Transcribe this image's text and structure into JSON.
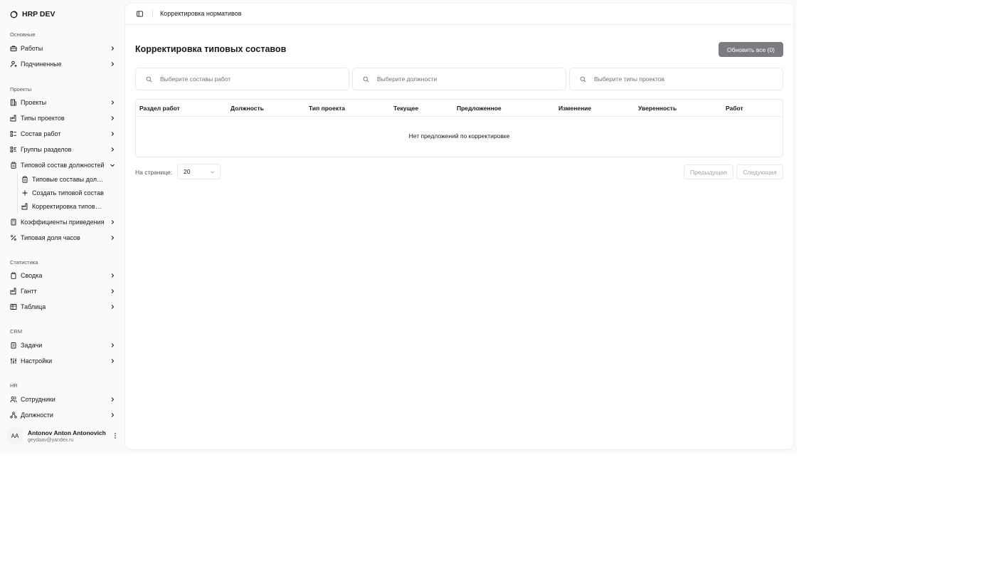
{
  "brand": {
    "name": "HRP DEV",
    "icon": "logo-icon"
  },
  "sidebar": {
    "groups": {
      "main": "Основные",
      "projects": "Проекты",
      "stats": "Статистика",
      "crm": "CRM",
      "hr": "HR"
    },
    "items": {
      "works": "Работы",
      "subordinates": "Подчиненные",
      "projects": "Проекты",
      "project_types": "Типы проектов",
      "work_composition": "Состав работ",
      "section_groups": "Группы разделов",
      "typical_positions": "Типовой состав должностей",
      "coefficients": "Коэффициенты приведения",
      "typical_hours": "Типовая доля часов",
      "summary": "Сводка",
      "gantt": "Гантт",
      "table": "Таблица",
      "tasks": "Задачи",
      "settings": "Настройки",
      "employees": "Сотрудники",
      "positions": "Должности"
    },
    "subitems": {
      "typical_list": "Типовые составы должностей",
      "create_typical": "Создать типовой состав",
      "adjust_typical": "Корректировка типовых составов"
    }
  },
  "user": {
    "initials": "AA",
    "name": "Antonov Anton Antonovich",
    "email": "geydaav@yandex.ru"
  },
  "topbar": {
    "breadcrumb": "Корректировка нормативов"
  },
  "page": {
    "title": "Корректировка типовых составов",
    "refresh_button": "Обновить все (0)"
  },
  "filters": {
    "work_compositions": "Выберите составы работ",
    "positions": "Выберите должности",
    "project_types": "Выберите типы проектов"
  },
  "table": {
    "columns": [
      "Раздел работ",
      "Должность",
      "Тип проекта",
      "Текущее",
      "Предложенное",
      "Изменение",
      "Уверенность",
      "Работ"
    ],
    "empty_message": "Нет предложений по корректировке"
  },
  "pagination": {
    "per_page_label": "На странице:",
    "per_page_value": "20",
    "prev": "Предыдущая",
    "next": "Следующая"
  },
  "colors": {
    "primary_button": "#7b7b80",
    "border": "#eaeaec",
    "muted_text": "#71717a"
  }
}
